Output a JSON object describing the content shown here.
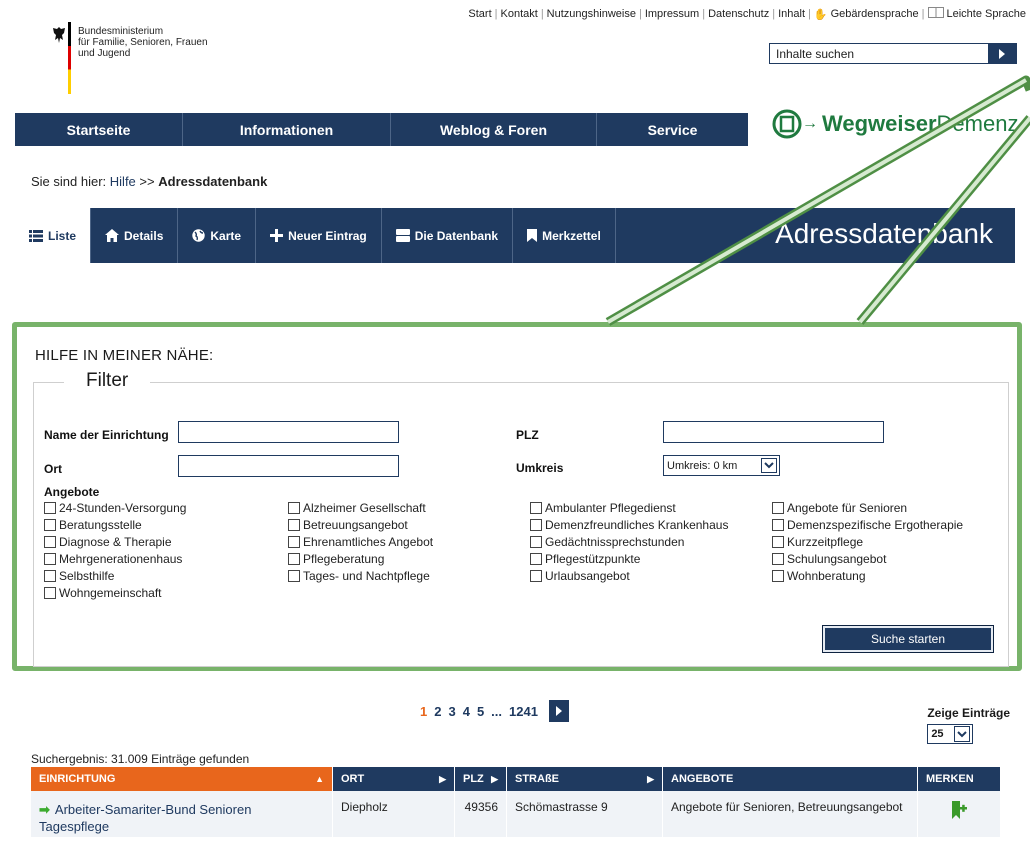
{
  "ministry": {
    "line1": "Bundesministerium",
    "line2": "für Familie, Senioren, Frauen",
    "line3": "und Jugend"
  },
  "topnav": {
    "items": [
      "Start",
      "Kontakt",
      "Nutzungshinweise",
      "Impressum",
      "Datenschutz",
      "Inhalt"
    ],
    "sign_language": "Gebärdensprache",
    "easy_language": "Leichte Sprache"
  },
  "search": {
    "placeholder": "Inhalte suchen"
  },
  "mainnav": {
    "items": [
      "Startseite",
      "Informationen",
      "Weblog & Foren",
      "Service"
    ]
  },
  "brand": {
    "bold": "Wegweiser",
    "light": "Demenz"
  },
  "breadcrumb": {
    "prefix": "Sie sind hier:",
    "link": "Hilfe",
    "separator": ">>",
    "current": "Adressdatenbank"
  },
  "tabs": {
    "items": [
      "Liste",
      "Details",
      "Karte",
      "Neuer Eintrag",
      "Die Datenbank",
      "Merkzettel"
    ],
    "title": "Adressdatenbank"
  },
  "filter": {
    "panel_title": "HILFE IN MEINER NÄHE:",
    "legend": "Filter",
    "name_label": "Name der Einrichtung",
    "plz_label": "PLZ",
    "ort_label": "Ort",
    "umkreis_label": "Umkreis",
    "umkreis_value": "Umkreis: 0 km",
    "angebote_label": "Angebote",
    "checkboxes": [
      "24-Stunden-Versorgung",
      "Alzheimer Gesellschaft",
      "Ambulanter Pflegedienst",
      "Angebote für Senioren",
      "Beratungsstelle",
      "Betreuungsangebot",
      "Demenzfreundliches Krankenhaus",
      "Demenzspezifische Ergotherapie",
      "Diagnose & Therapie",
      "Ehrenamtliches Angebot",
      "Gedächtnissprechstunden",
      "Kurzzeitpflege",
      "Mehrgenerationenhaus",
      "Pflegeberatung",
      "Pflegestützpunkte",
      "Schulungsangebot",
      "Selbsthilfe",
      "Tages- und Nachtpflege",
      "Urlaubsangebot",
      "Wohnberatung",
      "Wohngemeinschaft"
    ],
    "submit": "Suche starten"
  },
  "pagination": {
    "pages": [
      "1",
      "2",
      "3",
      "4",
      "5",
      "...",
      "1241"
    ],
    "current": "1"
  },
  "per_page": {
    "label": "Zeige Einträge",
    "value": "25"
  },
  "result_count": "Suchergebnis: 31.009 Einträge gefunden",
  "table": {
    "headers": [
      "EINRICHTUNG",
      "ORT",
      "PLZ",
      "STRAßE",
      "ANGEBOTE",
      "MERKEN"
    ],
    "rows": [
      {
        "name": "Arbeiter-Samariter-Bund Senioren Tagespflege",
        "ort": "Diepholz",
        "plz": "49356",
        "strasse": "Schömastrasse 9",
        "angebote": "Angebote für Senioren, Betreuungsangebot"
      }
    ]
  },
  "colors": {
    "navy": "#1f3a60",
    "orange": "#e8661c",
    "green": "#78b36a",
    "brand_green": "#1f7a3f"
  }
}
